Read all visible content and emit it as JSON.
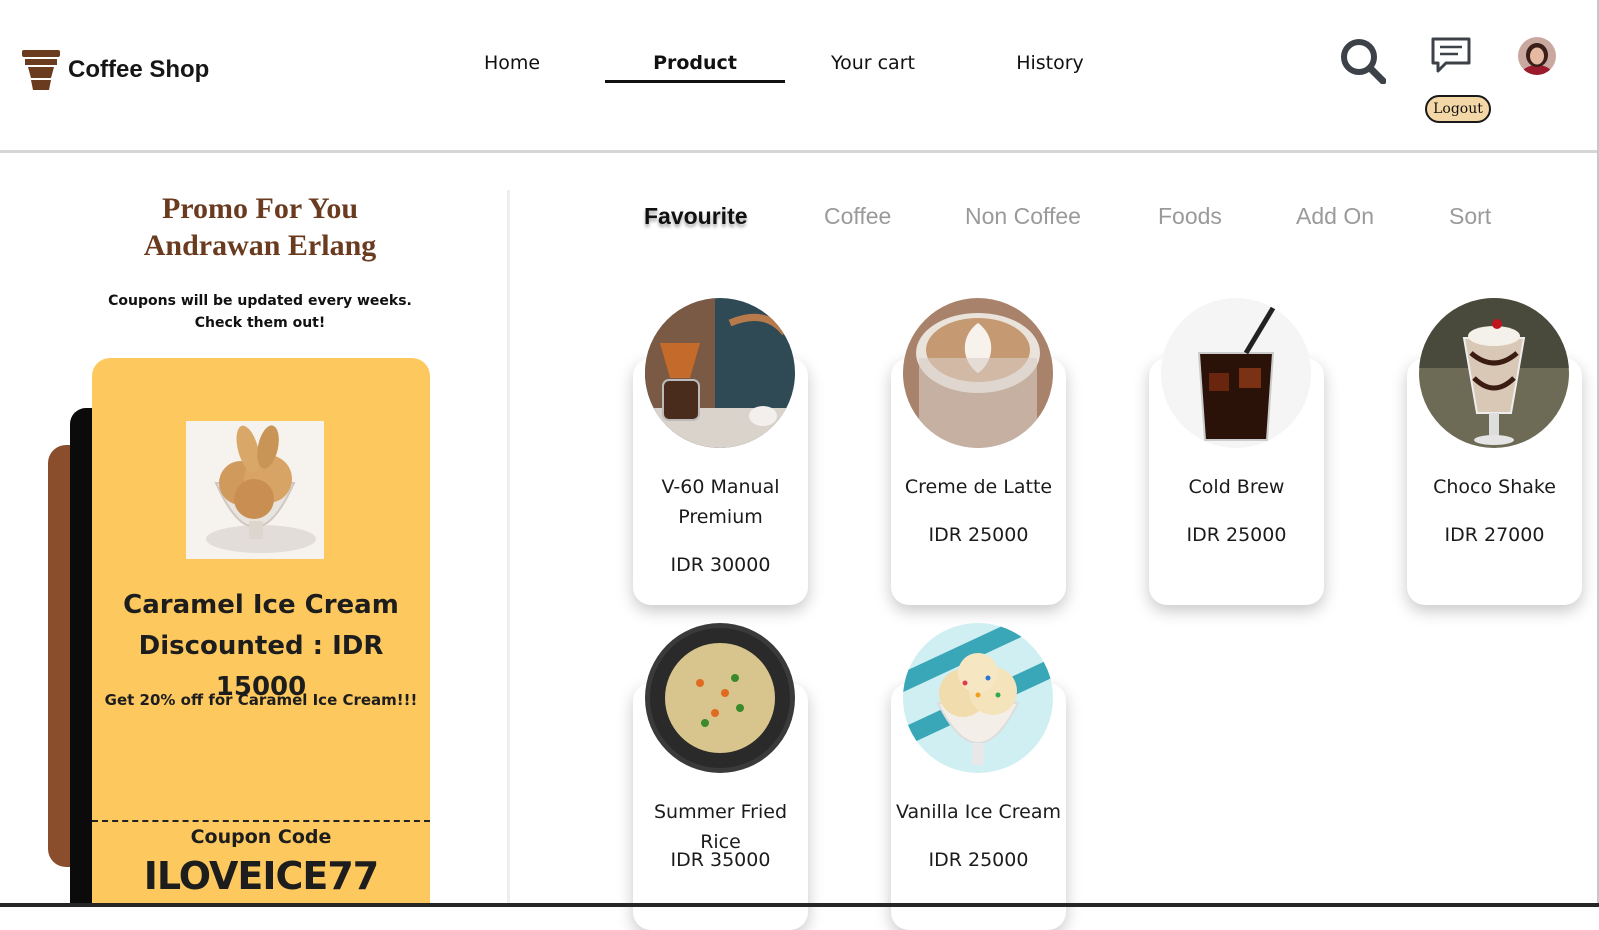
{
  "header": {
    "brand": "Coffee Shop",
    "nav": [
      {
        "label": "Home",
        "active": false
      },
      {
        "label": "Product",
        "active": true
      },
      {
        "label": "Your cart",
        "active": false
      },
      {
        "label": "History",
        "active": false
      }
    ],
    "logout_label": "Logout",
    "icons": [
      "coffee-cup-icon",
      "search-icon",
      "chat-icon",
      "avatar"
    ]
  },
  "promo": {
    "heading_line1": "Promo For You",
    "heading_line2": "Andrawan Erlang",
    "sub_line1": "Coupons will be updated every weeks.",
    "sub_line2": "Check them out!",
    "coupon": {
      "title_line1": "Caramel Ice Cream",
      "title_line2": "Discounted : IDR 15000",
      "description": "Get 20% off for Caramel Ice Cream!!!",
      "code_label": "Coupon Code",
      "code": "ILOVEICE77"
    }
  },
  "tabs": [
    {
      "label": "Favourite",
      "active": true
    },
    {
      "label": "Coffee",
      "active": false
    },
    {
      "label": "Non Coffee",
      "active": false
    },
    {
      "label": "Foods",
      "active": false
    },
    {
      "label": "Add On",
      "active": false
    },
    {
      "label": "Sort",
      "active": false
    }
  ],
  "products": [
    {
      "name_line1": "V-60 Manual",
      "name_line2": "Premium",
      "price": "IDR 30000"
    },
    {
      "name_line1": "Creme de Latte",
      "name_line2": "",
      "price": "IDR 25000"
    },
    {
      "name_line1": "Cold Brew",
      "name_line2": "",
      "price": "IDR 25000"
    },
    {
      "name_line1": "Choco Shake",
      "name_line2": "",
      "price": "IDR 27000"
    },
    {
      "name_line1": "Summer Fried Rice",
      "name_line2": "",
      "price": "IDR 35000"
    },
    {
      "name_line1": "Vanilla Ice Cream",
      "name_line2": "",
      "price": "IDR 25000"
    }
  ],
  "colors": {
    "brand_brown": "#6a3b1f",
    "coupon_yellow": "#fdc95e",
    "card_brown": "#8a4e2c",
    "logout_bg": "#f4d7a6",
    "tab_inactive": "#9a9a9a"
  }
}
